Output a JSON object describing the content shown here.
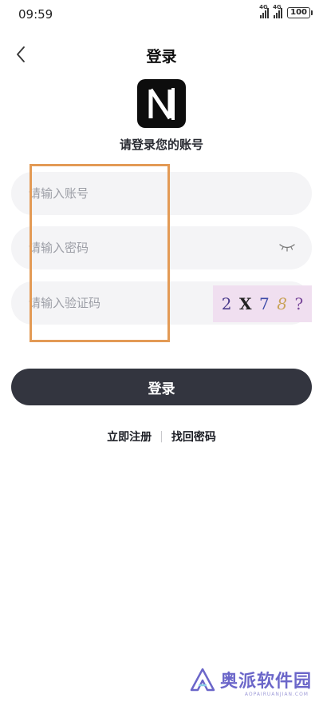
{
  "status_bar": {
    "time": "09:59",
    "network_1": "4G",
    "network_2": "4G",
    "battery": "100"
  },
  "header": {
    "title": "登录",
    "back_icon": "chevron-left-icon"
  },
  "logo": {
    "letter": "N",
    "subtitle": "请登录您的账号"
  },
  "form": {
    "account_placeholder": "请输入账号",
    "password_placeholder": "请输入密码",
    "captcha_placeholder": "请输入验证码",
    "captcha_chars": [
      "2",
      "X",
      "7",
      "8",
      "?"
    ],
    "eye_icon": "eye-closed-icon"
  },
  "actions": {
    "login_label": "登录",
    "register_label": "立即注册",
    "separator": "|",
    "recover_label": "找回密码"
  },
  "watermark": {
    "text": "奥派软件园",
    "sub": "AOPAIRUANJIAN.COM"
  },
  "colors": {
    "button_bg": "#33353f",
    "field_bg": "#f4f4f6",
    "highlight": "#e39a55",
    "watermark": "#6b66c9"
  }
}
